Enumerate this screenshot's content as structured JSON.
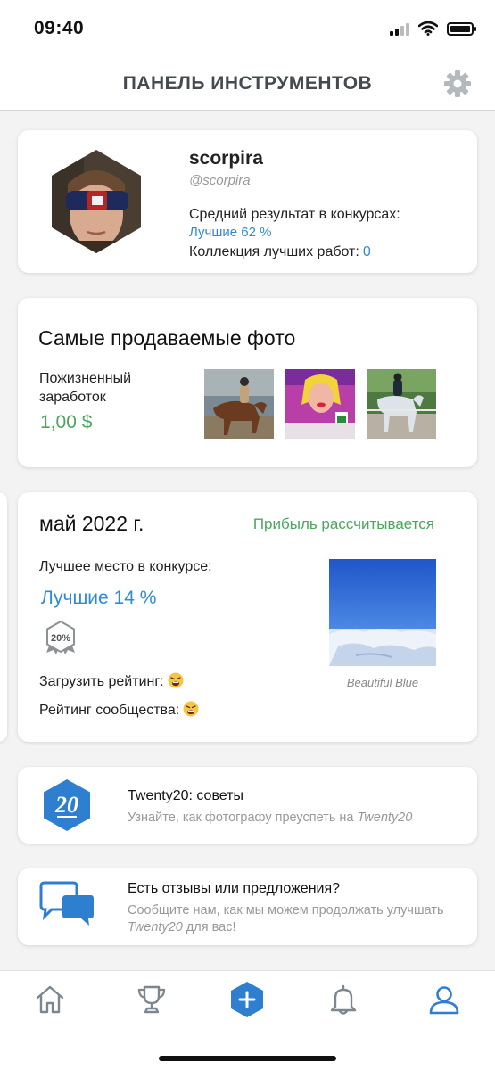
{
  "status_bar": {
    "time": "09:40"
  },
  "header": {
    "title": "ПАНЕЛЬ ИНСТРУМЕНТОВ",
    "settings_icon": "gear-icon"
  },
  "profile": {
    "username": "scorpira",
    "handle": "@scorpira",
    "avg_label": "Средний результат в конкурсах:",
    "avg_value": "Лучшие 62 %",
    "collection_label": "Коллекция лучших работ:",
    "collection_count": "0"
  },
  "best_selling": {
    "title": "Самые продаваемые фото",
    "lifetime_label": "Пожизненный заработок",
    "lifetime_value": "1,00 $"
  },
  "month": {
    "title": "май 2022 г.",
    "profit_status": "Прибыль рассчитывается",
    "best_place_label": "Лучшее место в конкурсе:",
    "best_place_value": "Лучшие 14 %",
    "badge_text": "20%",
    "upload_rating_label": "Загрузить рейтинг:",
    "community_rating_label": "Рейтинг сообщества:",
    "photo_caption": "Beautiful Blue"
  },
  "tips": {
    "title": "Twenty20: советы",
    "subtitle_prefix": "Узнайте, как фотографу преуспеть на ",
    "subtitle_brand": "Twenty20"
  },
  "feedback": {
    "title": "Есть отзывы или предложения?",
    "subtitle_prefix": "Сообщите нам, как мы можем продолжать улучшать ",
    "subtitle_brand": "Twenty20",
    "subtitle_suffix": " для вас!"
  },
  "tabbar": {
    "items": [
      "home-icon",
      "trophy-icon",
      "add-icon",
      "bell-icon",
      "profile-icon"
    ],
    "active": "profile-icon"
  },
  "colors": {
    "accent_blue": "#2f8ad8",
    "green": "#4ca65e",
    "header_text": "#444a50"
  }
}
